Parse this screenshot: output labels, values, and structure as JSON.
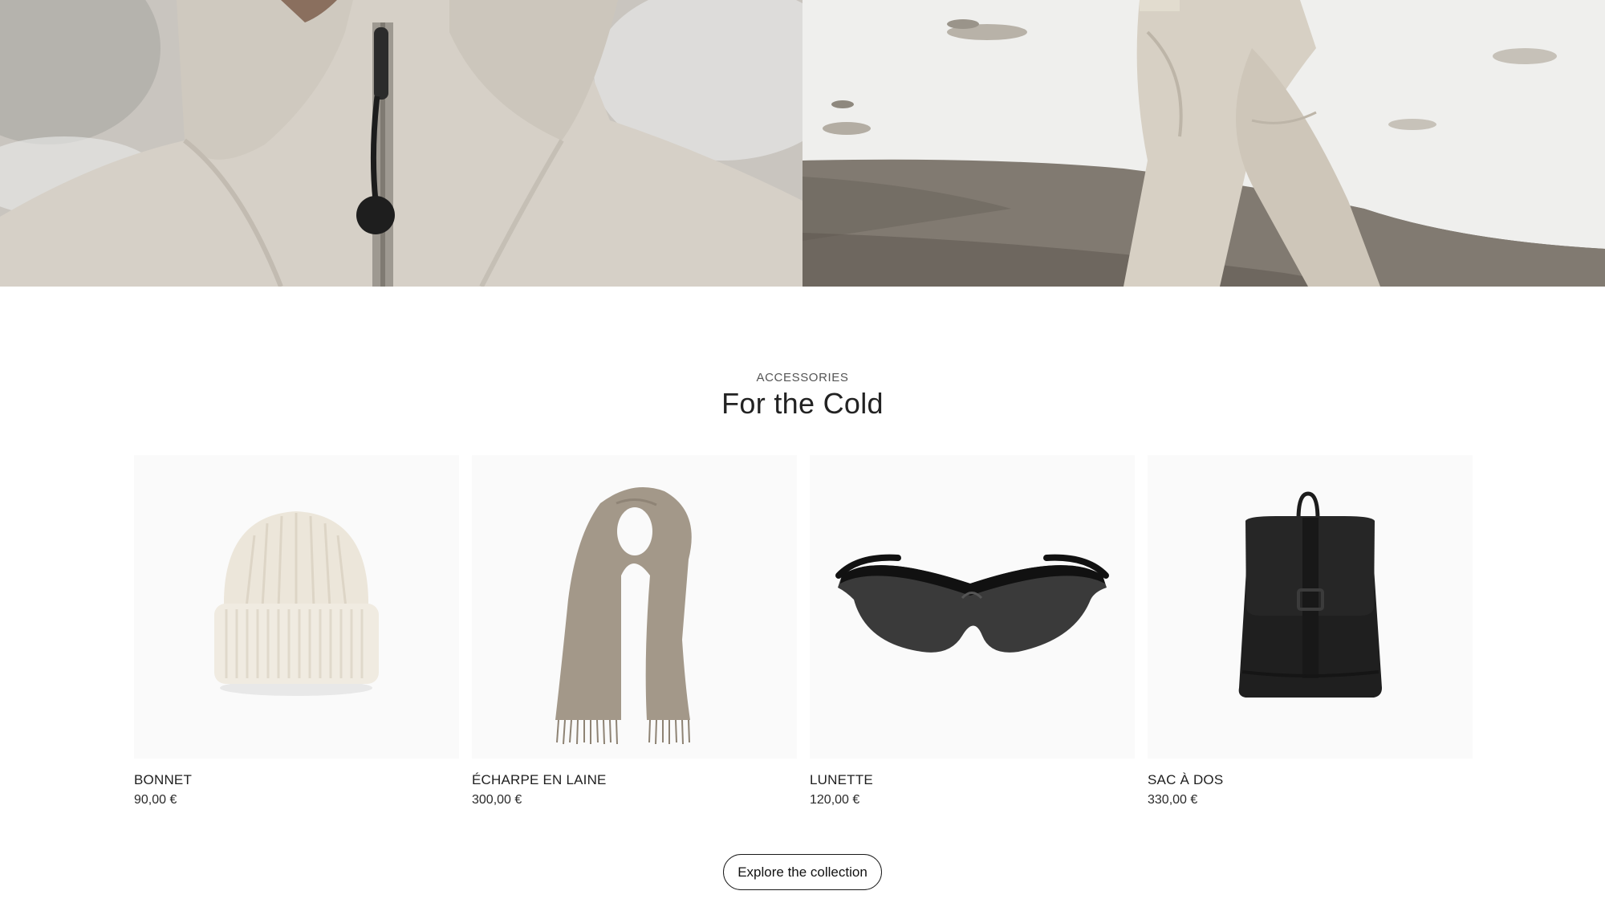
{
  "section": {
    "eyebrow": "ACCESSORIES",
    "title": "For the Cold"
  },
  "products": [
    {
      "name": "BONNET",
      "price": "90,00 €",
      "image": "beanie"
    },
    {
      "name": "ÉCHARPE EN LAINE",
      "price": "300,00 €",
      "image": "scarf"
    },
    {
      "name": "LUNETTE",
      "price": "120,00 €",
      "image": "sunglasses"
    },
    {
      "name": "SAC À DOS",
      "price": "330,00 €",
      "image": "backpack"
    }
  ],
  "cta": {
    "label": "Explore the collection"
  },
  "colors": {
    "background": "#ffffff",
    "text": "#1a1a1a",
    "thumb_bg": "#fafafa",
    "jacket": "#d3cdc4",
    "scarf": "#a1978a",
    "beanie": "#ede7db"
  }
}
